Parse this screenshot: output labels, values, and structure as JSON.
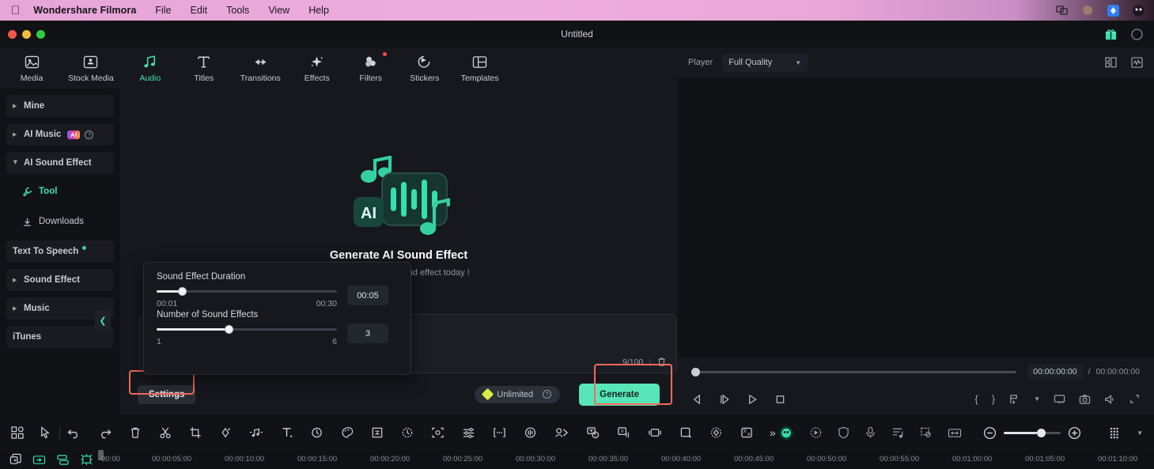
{
  "macbar": {
    "apple_icon": "apple-icon",
    "brand": "Wondershare Filmora",
    "menus": [
      "File",
      "Edit",
      "Tools",
      "View",
      "Help"
    ],
    "right_icons": [
      "window-switch-icon",
      "user-avatar-icon",
      "filmora-app-icon",
      "menu-extra-icon"
    ]
  },
  "titlebar": {
    "title": "Untitled",
    "right_icons": [
      "gift-icon",
      "account-circle-icon"
    ]
  },
  "tabs": [
    {
      "label": "Media",
      "icon": "media-icon",
      "active": false,
      "badge": false
    },
    {
      "label": "Stock Media",
      "icon": "stock-media-icon",
      "active": false,
      "badge": false
    },
    {
      "label": "Audio",
      "icon": "audio-note-icon",
      "active": true,
      "badge": false
    },
    {
      "label": "Titles",
      "icon": "titles-text-icon",
      "active": false,
      "badge": false
    },
    {
      "label": "Transitions",
      "icon": "transitions-arrow-icon",
      "active": false,
      "badge": false
    },
    {
      "label": "Effects",
      "icon": "effects-sparkle-icon",
      "active": false,
      "badge": false
    },
    {
      "label": "Filters",
      "icon": "filters-circles-icon",
      "active": false,
      "badge": true
    },
    {
      "label": "Stickers",
      "icon": "stickers-icon",
      "active": false,
      "badge": false
    },
    {
      "label": "Templates",
      "icon": "templates-layout-icon",
      "active": false,
      "badge": false
    }
  ],
  "sidebar": {
    "items": [
      {
        "label": "Mine",
        "type": "group",
        "expanded": false
      },
      {
        "label": "AI Music",
        "type": "group",
        "expanded": false,
        "badge": "AI",
        "help": true
      },
      {
        "label": "AI Sound Effect",
        "type": "group",
        "expanded": true
      },
      {
        "label": "Tool",
        "type": "sub",
        "active": true,
        "icon": "tool-wrench-icon"
      },
      {
        "label": "Downloads",
        "type": "sub",
        "active": false,
        "icon": "download-icon"
      },
      {
        "label": "Text To Speech",
        "type": "flat",
        "new_dot": true
      },
      {
        "label": "Sound Effect",
        "type": "group",
        "expanded": false
      },
      {
        "label": "Music",
        "type": "group",
        "expanded": false
      },
      {
        "label": "iTunes",
        "type": "flat"
      }
    ],
    "collapse_icon": "chevron-left-icon"
  },
  "main": {
    "hero_title": "Generate AI Sound Effect",
    "hero_subtitle": "Create your own sound effect today !",
    "hero_art": "ai-sound-waveform-icon",
    "prompt": {
      "value": "",
      "placeholder": "",
      "counter": "9/100",
      "delete_icon": "trash-icon"
    },
    "settings_label": "Settings",
    "unlimited_label": "Unlimited",
    "unlimited_icon": "diamond-icon",
    "unlimited_help_icon": "help-circle-icon",
    "generate_label": "Generate",
    "highlight_color": "#f4695c"
  },
  "popover": {
    "duration": {
      "label": "Sound Effect Duration",
      "min_label": "00:01",
      "max_label": "00:30",
      "value": "00:05",
      "fill_percent": 14
    },
    "count": {
      "label": "Number of Sound Effects",
      "min_label": "1",
      "max_label": "6",
      "value": "3",
      "fill_percent": 40
    }
  },
  "player": {
    "label": "Player",
    "quality": "Full Quality",
    "quality_caret": "chevron-down-icon",
    "header_icons": [
      "split-view-icon",
      "waveform-view-icon"
    ],
    "current_time": "00:00:00:00",
    "separator": "/",
    "total_time": "00:00:00:00",
    "transport": [
      "prev-frame-icon",
      "next-frame-icon",
      "play-icon",
      "stop-icon"
    ],
    "right_controls": [
      "mark-in-icon",
      "mark-out-icon",
      "export-frame-icon",
      "caret-down-icon",
      "display-icon",
      "snapshot-icon",
      "volume-icon",
      "expand-icon"
    ],
    "seek_percent": 0
  },
  "timeline_toolbar": {
    "left_icons": [
      "apps-grid-icon",
      "select-pointer-icon"
    ],
    "edit_icons": [
      "undo-icon",
      "redo-icon",
      "delete-icon",
      "cut-icon",
      "crop-icon",
      "color-match-icon",
      "audio-detach-icon",
      "text-icon",
      "speed-icon",
      "color-icon",
      "auto-reframe-icon",
      "stabilize-icon",
      "motion-tracking-icon",
      "adjust-icon",
      "silence-detect-icon",
      "audio-ducking-icon",
      "smart-cutout-icon",
      "text-based-edit-icon",
      "ai-audio-icon",
      "keyframe-icon",
      "mask-icon",
      "sticker-icon",
      "translate-icon",
      "more-chevron-icon"
    ],
    "right_icons": [
      "ai-assistant-icon",
      "render-preview-icon",
      "shield-icon",
      "mic-record-icon",
      "audio-mixer-icon",
      "markers-icon",
      "fit-timeline-icon"
    ],
    "zoom_out_icon": "zoom-out-icon",
    "zoom_in_icon": "zoom-in-icon",
    "zoom_percent": 58,
    "track_manager_icon": "track-manager-icon",
    "track_caret_icon": "caret-down-icon"
  },
  "ruler": {
    "track_icons": [
      "add-media-icon",
      "link-icon",
      "align-icon",
      "mask-track-icon"
    ],
    "ticks": [
      "00:00",
      "00:00:05:00",
      "00:00:10:00",
      "00:00:15:00",
      "00:00:20:00",
      "00:00:25:00",
      "00:00:30:00",
      "00:00:35:00",
      "00:00:40:00",
      "00:00:45:00",
      "00:00:50:00",
      "00:00:55:00",
      "00:01:00:00",
      "00:01:05:00",
      "00:01:10:00"
    ]
  }
}
